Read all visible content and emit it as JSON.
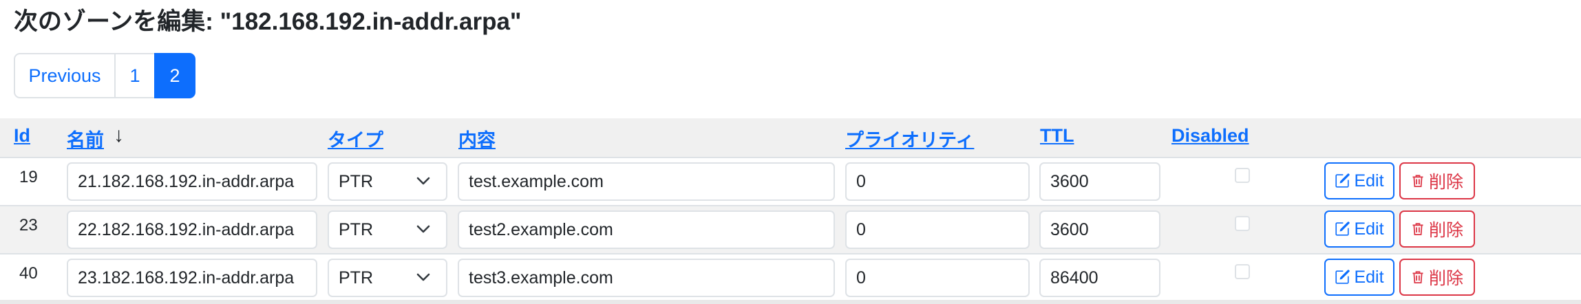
{
  "title": "次のゾーンを編集: \"182.168.192.in-addr.arpa\"",
  "pagination": {
    "previous_label": "Previous",
    "pages": [
      "1",
      "2"
    ],
    "active_page": "2"
  },
  "table": {
    "headers": {
      "id": "Id",
      "name": "名前",
      "name_sort": "↓",
      "type": "タイプ",
      "content": "内容",
      "priority": "プライオリティ",
      "ttl": "TTL",
      "disabled": "Disabled"
    },
    "rows": [
      {
        "id": "19",
        "name": "21.182.168.192.in-addr.arpa",
        "type": "PTR",
        "content": "test.example.com",
        "priority": "0",
        "ttl": "3600",
        "disabled": false
      },
      {
        "id": "23",
        "name": "22.182.168.192.in-addr.arpa",
        "type": "PTR",
        "content": "test2.example.com",
        "priority": "0",
        "ttl": "3600",
        "disabled": false
      },
      {
        "id": "40",
        "name": "23.182.168.192.in-addr.arpa",
        "type": "PTR",
        "content": "test3.example.com",
        "priority": "0",
        "ttl": "86400",
        "disabled": false
      }
    ],
    "edit_label": "Edit",
    "delete_label": "削除"
  },
  "colors": {
    "primary": "#0d6efd",
    "danger": "#dc3545"
  },
  "icons": {
    "edit": "pencil-square-icon",
    "delete": "trash-icon",
    "select": "chevron-down-icon"
  }
}
